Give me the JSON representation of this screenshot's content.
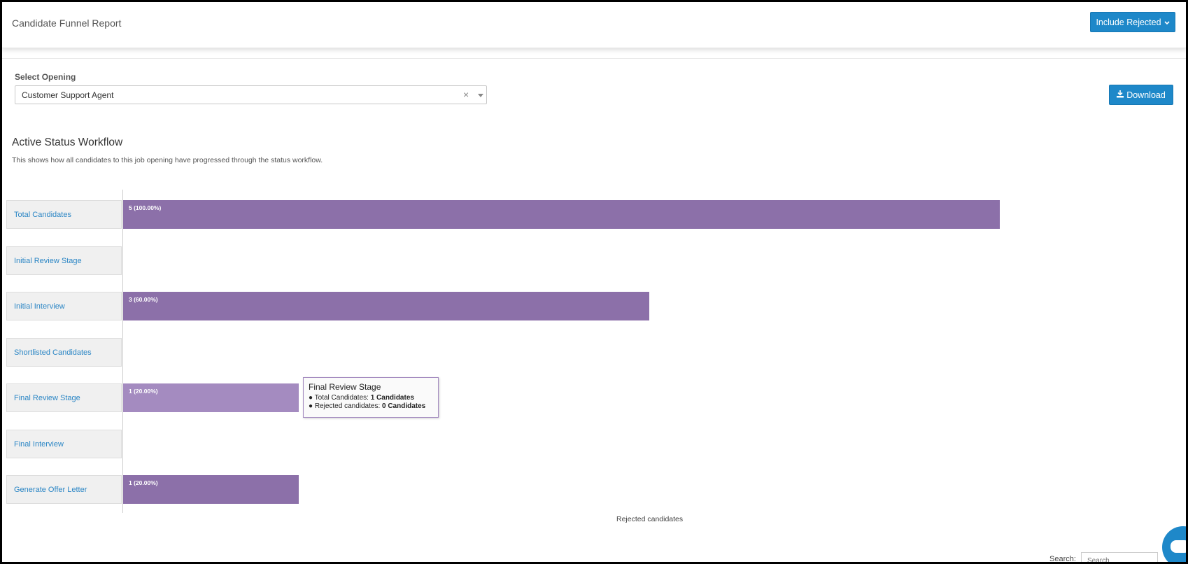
{
  "header": {
    "title": "Candidate Funnel Report",
    "include_rejected_label": "Include Rejected",
    "include_rejected_icon": "chevron-down-icon"
  },
  "filters": {
    "select_opening_label": "Select Opening",
    "selected_opening": "Customer Support Agent",
    "clear_symbol": "×",
    "download_label": "Download",
    "download_icon": "download-icon"
  },
  "section": {
    "title": "Active Status Workflow",
    "description": "This shows how all candidates to this job opening have progressed through the status workflow."
  },
  "chart_data": {
    "type": "bar",
    "orientation": "horizontal",
    "categories": [
      "Total Candidates",
      "Initial Review Stage",
      "Initial Interview",
      "Shortlisted Candidates",
      "Final Review Stage",
      "Final Interview",
      "Generate Offer Letter"
    ],
    "values": [
      5,
      0,
      3,
      0,
      1,
      0,
      1
    ],
    "value_labels": [
      "5 (100.00%)",
      "",
      "3 (60.00%)",
      "",
      "1 (20.00%)",
      "",
      "1 (20.00%)"
    ],
    "max": 5,
    "bar_color": "#8c70a9",
    "highlight_color": "#a48bc0",
    "legend": [
      "Rejected candidates"
    ]
  },
  "tooltip": {
    "title": "Final Review Stage",
    "row1_label": "Total Candidates: ",
    "row1_value": "1 Candidates",
    "row2_label": "Rejected candidates: ",
    "row2_value": "0 Candidates"
  },
  "table": {
    "search_label": "Search:",
    "search_placeholder": "Search"
  },
  "chat": {
    "icon": "chat-icon"
  }
}
